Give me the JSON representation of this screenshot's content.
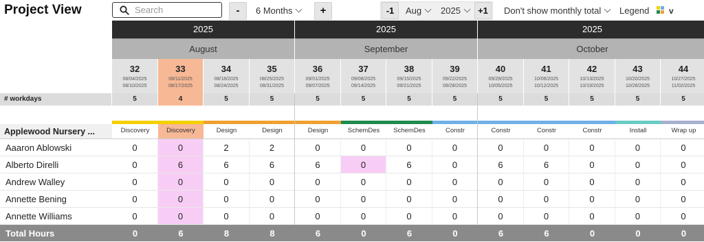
{
  "toolbar": {
    "title": "Project View",
    "search_placeholder": "Search",
    "minus_label": "-",
    "range_value": "6 Months",
    "plus_label": "+",
    "prev_label": "-1",
    "month_value": "Aug",
    "year_value": "2025",
    "next_label": "+1",
    "monthly_total_option": "Don't show monthly total",
    "legend_label": "Legend",
    "legend_chevron": "v",
    "legend_colors": [
      "#f5d000",
      "#f0a030",
      "#1e8a4e",
      "#6fb0e8"
    ]
  },
  "years": [
    "2025",
    "2025",
    "2025"
  ],
  "months": [
    "August",
    "September",
    "October"
  ],
  "weeks": [
    {
      "num": "32",
      "start": "08/04/2025",
      "end": "08/10/2025",
      "workdays": "5",
      "phase": "Discovery",
      "current": false
    },
    {
      "num": "33",
      "start": "08/11/2025",
      "end": "08/17/2025",
      "workdays": "4",
      "phase": "Discovery",
      "current": true
    },
    {
      "num": "34",
      "start": "08/18/2025",
      "end": "08/24/2025",
      "workdays": "5",
      "phase": "Design",
      "current": false
    },
    {
      "num": "35",
      "start": "08/25/2025",
      "end": "08/31/2025",
      "workdays": "5",
      "phase": "Design",
      "current": false
    },
    {
      "num": "36",
      "start": "09/01/2025",
      "end": "09/07/2025",
      "workdays": "5",
      "phase": "Design",
      "current": false
    },
    {
      "num": "37",
      "start": "09/08/2025",
      "end": "09/14/2025",
      "workdays": "5",
      "phase": "SchemDes",
      "current": false
    },
    {
      "num": "38",
      "start": "09/15/2025",
      "end": "09/21/2025",
      "workdays": "5",
      "phase": "SchemDes",
      "current": false
    },
    {
      "num": "39",
      "start": "09/22/2025",
      "end": "09/28/2025",
      "workdays": "5",
      "phase": "Constr",
      "current": false
    },
    {
      "num": "40",
      "start": "09/29/2025",
      "end": "10/05/2025",
      "workdays": "5",
      "phase": "Constr",
      "current": false
    },
    {
      "num": "41",
      "start": "10/06/2025",
      "end": "10/12/2025",
      "workdays": "5",
      "phase": "Constr",
      "current": false
    },
    {
      "num": "42",
      "start": "10/13/2025",
      "end": "10/19/2025",
      "workdays": "5",
      "phase": "Constr",
      "current": false
    },
    {
      "num": "43",
      "start": "10/20/2025",
      "end": "10/26/2025",
      "workdays": "5",
      "phase": "Install",
      "current": false
    },
    {
      "num": "44",
      "start": "10/27/2025",
      "end": "11/02/2025",
      "workdays": "5",
      "phase": "Wrap up",
      "current": false
    }
  ],
  "phase_colors": [
    "#f5d000",
    "#f5d000",
    "#f0a030",
    "#f0a030",
    "#f0a030",
    "#1e8a4e",
    "#1e8a4e",
    "#6fb0e8",
    "#6fb0e8",
    "#6fb0e8",
    "#6fb0e8",
    "#66ccc4",
    "#a8b0d0"
  ],
  "workdays_label": "# workdays",
  "project_name": "Applewood Nursery ...",
  "people": [
    {
      "name": "Aaaron Ablowski",
      "values": [
        "0",
        "0",
        "2",
        "2",
        "0",
        "0",
        "0",
        "0",
        "0",
        "0",
        "0",
        "0",
        "0"
      ],
      "highlight": [
        1
      ]
    },
    {
      "name": "Alberto Direlli",
      "values": [
        "0",
        "6",
        "6",
        "6",
        "6",
        "0",
        "6",
        "0",
        "6",
        "6",
        "0",
        "0",
        "0"
      ],
      "highlight": [
        1,
        5
      ]
    },
    {
      "name": "Andrew Walley",
      "values": [
        "0",
        "0",
        "0",
        "0",
        "0",
        "0",
        "0",
        "0",
        "0",
        "0",
        "0",
        "0",
        "0"
      ],
      "highlight": [
        1
      ]
    },
    {
      "name": "Annette Bening",
      "values": [
        "0",
        "0",
        "0",
        "0",
        "0",
        "0",
        "0",
        "0",
        "0",
        "0",
        "0",
        "0",
        "0"
      ],
      "highlight": [
        1
      ]
    },
    {
      "name": "Annette Williams",
      "values": [
        "0",
        "0",
        "0",
        "0",
        "0",
        "0",
        "0",
        "0",
        "0",
        "0",
        "0",
        "0",
        "0"
      ],
      "highlight": [
        1
      ]
    }
  ],
  "total": {
    "label": "Total Hours",
    "values": [
      "0",
      "6",
      "8",
      "8",
      "6",
      "0",
      "6",
      "0",
      "6",
      "6",
      "0",
      "0",
      "0"
    ]
  },
  "colors": {
    "current_week": "#f7b896",
    "highlight_cell": "#f8cdf5",
    "year_bar": "#2c2c2c",
    "month_bar": "#b3b3b3"
  }
}
